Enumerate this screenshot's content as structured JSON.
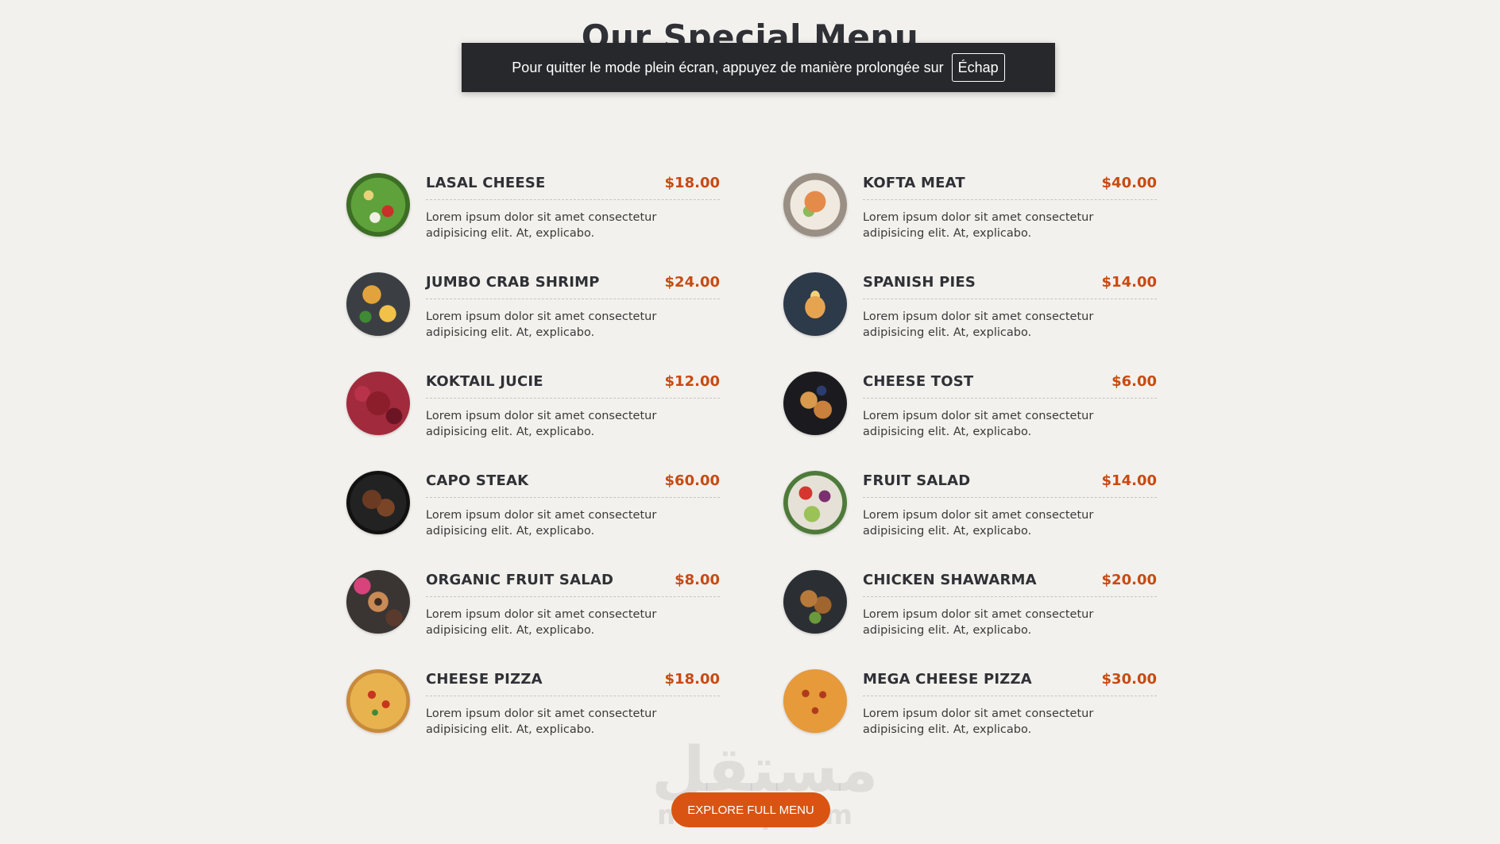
{
  "section": {
    "title": "Our Special Menu"
  },
  "fullscreen_notice": {
    "message": "Pour quitter le mode plein écran, appuyez de manière prolongée sur",
    "key": "Échap"
  },
  "menu": {
    "items": [
      {
        "name": "LASAL CHEESE",
        "price": "$18.00",
        "description": "Lorem ipsum dolor sit amet consectetur adipisicing elit. At, explicabo.",
        "image": "salad-photo"
      },
      {
        "name": "KOFTA MEAT",
        "price": "$40.00",
        "description": "Lorem ipsum dolor sit amet consectetur adipisicing elit. At, explicabo.",
        "image": "meat-plate-photo"
      },
      {
        "name": "JUMBO CRAB SHRIMP",
        "price": "$24.00",
        "description": "Lorem ipsum dolor sit amet consectetur adipisicing elit. At, explicabo.",
        "image": "shrimp-dish-photo"
      },
      {
        "name": "SPANISH PIES",
        "price": "$14.00",
        "description": "Lorem ipsum dolor sit amet consectetur adipisicing elit. At, explicabo.",
        "image": "pancake-stack-photo"
      },
      {
        "name": "KOKTAIL JUCIE",
        "price": "$12.00",
        "description": "Lorem ipsum dolor sit amet consectetur adipisicing elit. At, explicabo.",
        "image": "berry-juice-photo"
      },
      {
        "name": "CHEESE TOST",
        "price": "$6.00",
        "description": "Lorem ipsum dolor sit amet consectetur adipisicing elit. At, explicabo.",
        "image": "french-toast-photo"
      },
      {
        "name": "CAPO STEAK",
        "price": "$60.00",
        "description": "Lorem ipsum dolor sit amet consectetur adipisicing elit. At, explicabo.",
        "image": "steak-pan-photo"
      },
      {
        "name": "FRUIT SALAD",
        "price": "$14.00",
        "description": "Lorem ipsum dolor sit amet consectetur adipisicing elit. At, explicabo.",
        "image": "fruit-salad-photo"
      },
      {
        "name": "ORGANIC FRUIT SALAD",
        "price": "$8.00",
        "description": "Lorem ipsum dolor sit amet consectetur adipisicing elit. At, explicabo.",
        "image": "donuts-photo"
      },
      {
        "name": "CHICKEN SHAWARMA",
        "price": "$20.00",
        "description": "Lorem ipsum dolor sit amet consectetur adipisicing elit. At, explicabo.",
        "image": "shawarma-photo"
      },
      {
        "name": "CHEESE PIZZA",
        "price": "$18.00",
        "description": "Lorem ipsum dolor sit amet consectetur adipisicing elit. At, explicabo.",
        "image": "pizza-photo"
      },
      {
        "name": "MEGA CHEESE PIZZA",
        "price": "$30.00",
        "description": "Lorem ipsum dolor sit amet consectetur adipisicing elit. At, explicabo.",
        "image": "large-pizza-photo"
      }
    ]
  },
  "cta": {
    "label": "EXPLORE FULL MENU"
  },
  "watermark": {
    "arabic": "مستقل",
    "latin": "mostaql.com"
  },
  "colors": {
    "background": "#f3f1ed",
    "price": "#c74b12",
    "button": "#d95412",
    "toast": "#26282c"
  }
}
